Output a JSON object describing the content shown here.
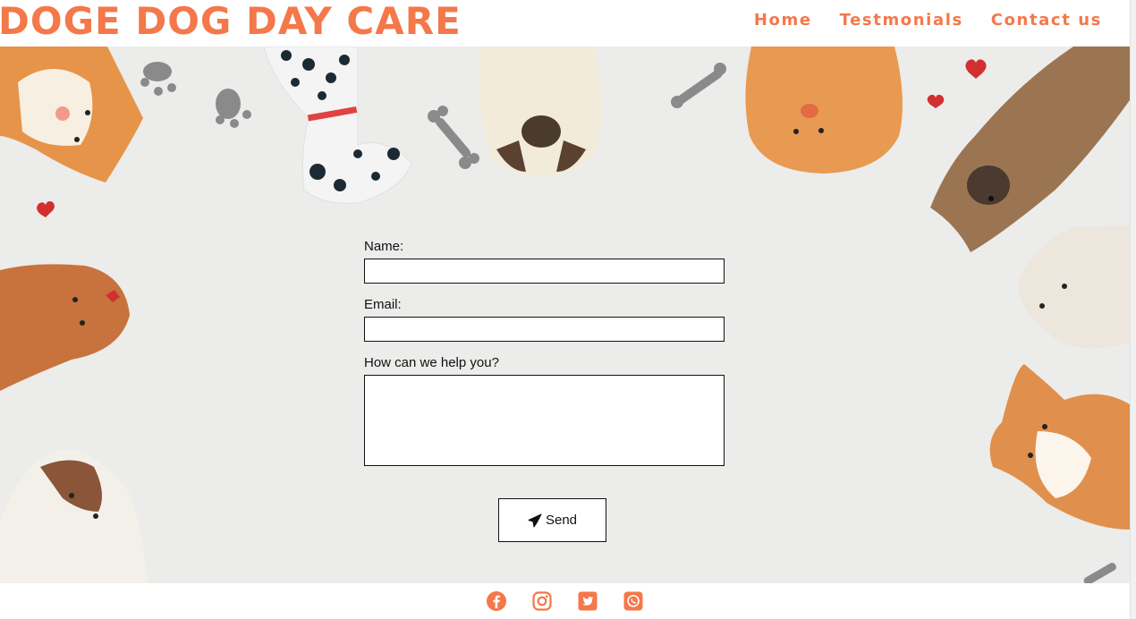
{
  "brand": {
    "title": "DOGE DOG DAY CARE"
  },
  "nav": {
    "items": [
      {
        "label": "Home"
      },
      {
        "label": "Testmonials"
      },
      {
        "label": "Contact us"
      }
    ]
  },
  "form": {
    "name_label": "Name:",
    "name_value": "",
    "email_label": "Email:",
    "email_value": "",
    "message_label": "How can we help you?",
    "message_value": "",
    "send_label": "Send"
  },
  "footer": {
    "icons": [
      "facebook-icon",
      "instagram-icon",
      "twitter-icon",
      "whatsapp-icon"
    ]
  },
  "colors": {
    "accent": "#f4784a",
    "background": "#ececeb"
  }
}
